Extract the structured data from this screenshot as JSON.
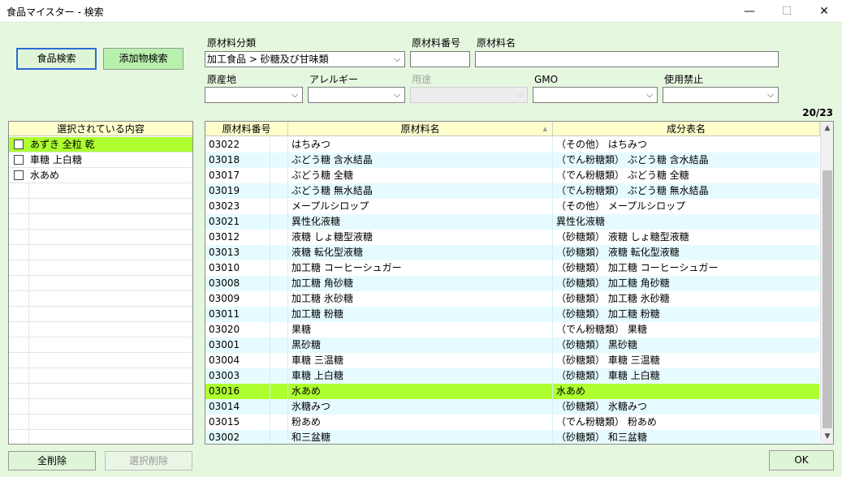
{
  "window": {
    "title": "食品マイスター - 検索",
    "min": "—",
    "max": "☐",
    "close": "✕"
  },
  "buttons": {
    "food_search": "食品検索",
    "additive_search": "添加物検索",
    "delete_all": "全削除",
    "delete_selected": "選択削除",
    "ok": "OK"
  },
  "filters": {
    "category_label": "原材料分類",
    "category_value": "加工食品 > 砂糖及び甘味類",
    "number_label": "原材料番号",
    "number_value": "",
    "name_label": "原材料名",
    "name_value": "",
    "origin_label": "原産地",
    "origin_value": "",
    "allergy_label": "アレルギー",
    "allergy_value": "",
    "usage_label": "用途",
    "usage_value": "",
    "gmo_label": "GMO",
    "gmo_value": "",
    "ban_label": "使用禁止",
    "ban_value": ""
  },
  "count": "20/23",
  "selected": {
    "header": "選択されている内容",
    "items": [
      {
        "label": "あずき 全粒 乾",
        "highlighted": true
      },
      {
        "label": "車糖 上白糖",
        "highlighted": false
      },
      {
        "label": "水あめ",
        "highlighted": false
      }
    ]
  },
  "results": {
    "columns": [
      "原材料番号",
      "原材料名",
      "成分表名"
    ],
    "sort_indicator": "▲",
    "rows": [
      [
        "03022",
        "はちみつ",
        "（その他） はちみつ"
      ],
      [
        "03018",
        "ぶどう糖 含水結晶",
        "（でん粉糖類） ぶどう糖 含水結晶"
      ],
      [
        "03017",
        "ぶどう糖 全糖",
        "（でん粉糖類） ぶどう糖 全糖"
      ],
      [
        "03019",
        "ぶどう糖 無水結晶",
        "（でん粉糖類） ぶどう糖 無水結晶"
      ],
      [
        "03023",
        "メープルシロップ",
        "（その他） メープルシロップ"
      ],
      [
        "03021",
        "異性化液糖",
        "異性化液糖"
      ],
      [
        "03012",
        "液糖 しょ糖型液糖",
        "（砂糖類） 液糖 しょ糖型液糖"
      ],
      [
        "03013",
        "液糖 転化型液糖",
        "（砂糖類） 液糖 転化型液糖"
      ],
      [
        "03010",
        "加工糖 コーヒーシュガー",
        "（砂糖類） 加工糖 コーヒーシュガー"
      ],
      [
        "03008",
        "加工糖 角砂糖",
        "（砂糖類） 加工糖 角砂糖"
      ],
      [
        "03009",
        "加工糖 氷砂糖",
        "（砂糖類） 加工糖 氷砂糖"
      ],
      [
        "03011",
        "加工糖 粉糖",
        "（砂糖類） 加工糖 粉糖"
      ],
      [
        "03020",
        "果糖",
        "（でん粉糖類） 果糖"
      ],
      [
        "03001",
        "黒砂糖",
        "（砂糖類） 黒砂糖"
      ],
      [
        "03004",
        "車糖 三温糖",
        "（砂糖類） 車糖 三温糖"
      ],
      [
        "03003",
        "車糖 上白糖",
        "（砂糖類） 車糖 上白糖"
      ],
      [
        "03016",
        "水あめ",
        "水あめ"
      ],
      [
        "03014",
        "氷糖みつ",
        "（砂糖類） 氷糖みつ"
      ],
      [
        "03015",
        "粉あめ",
        "（でん粉糖類） 粉あめ"
      ],
      [
        "03002",
        "和三盆糖",
        "（砂糖類） 和三盆糖"
      ]
    ],
    "highlighted_row": 16
  },
  "icons": {
    "dropdown": "chevron-down-icon",
    "scroll_up": "scroll-up-arrow-icon",
    "scroll_down": "scroll-down-arrow-icon"
  },
  "colors": {
    "background": "#e6f7e0",
    "highlight": "#adff2f",
    "header": "#ffffcc",
    "alt_row": "#e6fbff"
  }
}
